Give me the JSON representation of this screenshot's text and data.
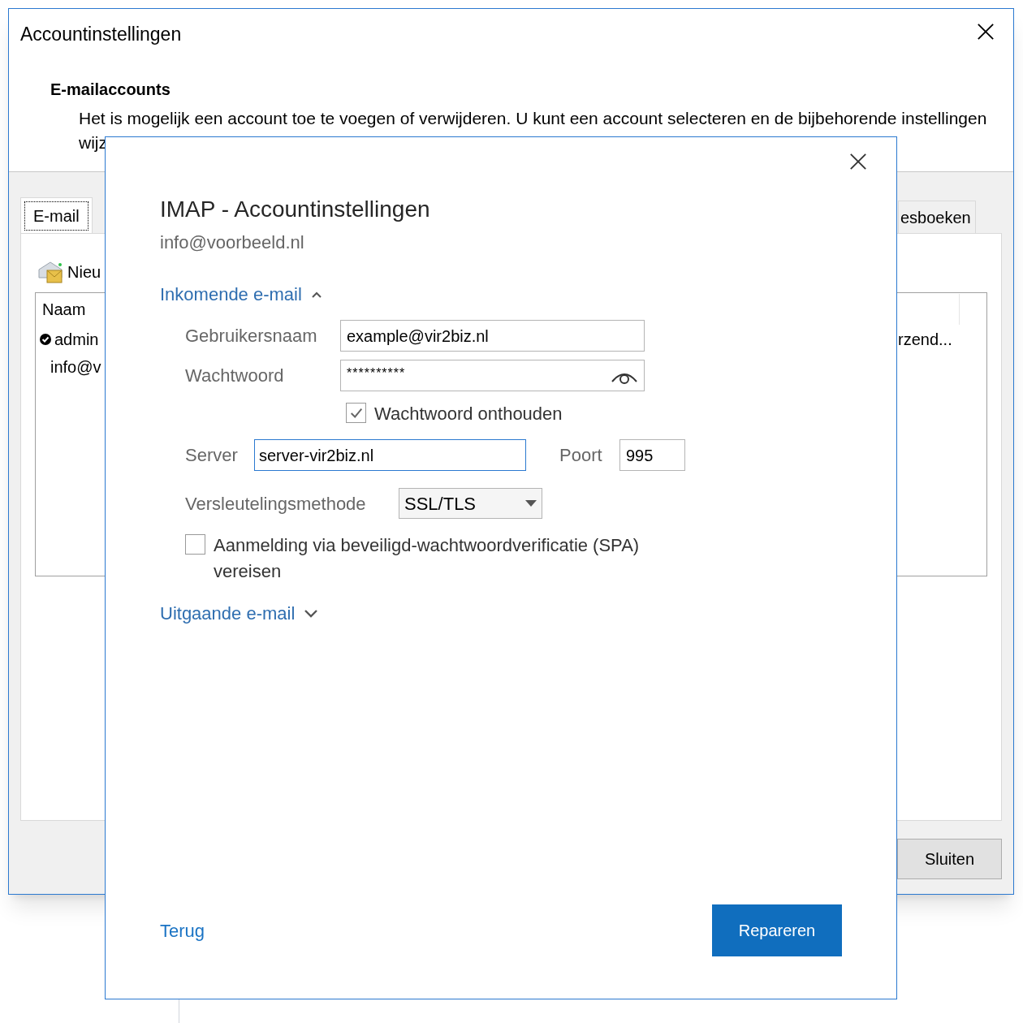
{
  "background_window": {
    "title": "Accountinstellingen",
    "heading": "E-mailaccounts",
    "description": "Het is mogelijk een account toe te voegen of verwijderen. U kunt een account selecteren en de bijbehorende instellingen wijz",
    "tabs": [
      {
        "label": "E-mail",
        "selected": true
      },
      {
        "label": "esboeken",
        "selected": false
      }
    ],
    "toolbar_button": "Nieu",
    "list": {
      "column_1": "Naam",
      "rows": [
        {
          "name": "admin",
          "default": true,
          "column_2": "rzend..."
        },
        {
          "name": "info@v",
          "default": false
        }
      ]
    },
    "close_button": "Sluiten"
  },
  "dialog": {
    "title": "IMAP - Accountinstellingen",
    "account": "info@voorbeeld.nl",
    "incoming": {
      "label": "Inkomende e-mail",
      "expanded": true,
      "username": {
        "label": "Gebruikersnaam",
        "value": "example@vir2biz.nl"
      },
      "password": {
        "label": "Wachtwoord",
        "value": "**********"
      },
      "remember": {
        "label": "Wachtwoord onthouden",
        "checked": true
      },
      "server": {
        "label": "Server",
        "value": "server-vir2biz.nl",
        "focused": true
      },
      "port": {
        "label": "Poort",
        "value": "995"
      },
      "encryption": {
        "label": "Versleutelingsmethode",
        "value": "SSL/TLS"
      },
      "spa": {
        "label": "Aanmelding via beveiligd-wachtwoordverificatie (SPA) vereisen",
        "checked": false
      }
    },
    "outgoing": {
      "label": "Uitgaande e-mail",
      "expanded": false
    },
    "back_link": "Terug",
    "repair_button": "Repareren"
  }
}
